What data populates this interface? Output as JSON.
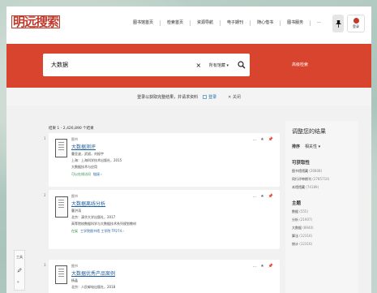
{
  "header": {
    "logo_text": "明远搜索",
    "nav": [
      "图书馆首页",
      "检索首页",
      "资源导航",
      "电子期刊",
      "随心借书",
      "图书服务",
      "···"
    ],
    "login_label": "登录",
    "pin_icon": "pin-icon"
  },
  "search": {
    "query": "大数据",
    "clear_symbol": "×",
    "scope": "所有馆藏 ▾",
    "advanced": "高级检索"
  },
  "notice": {
    "text": "登录以获取完整结果，并请求资料",
    "login_label": "登录",
    "dismiss_label": "✕ 关闭"
  },
  "results": {
    "count_text": "结果 1 - 2,426,890 个结果",
    "items": [
      {
        "num": "1",
        "type": "图书",
        "title": "大数据测评",
        "line1": "曹亚波，武斌，刘振宇",
        "line2": "上海：上海科学技术出版社，2015",
        "line3": "大数据技术与应用",
        "avail": "可以在线访问",
        "avail_more": "链接 ›"
      },
      {
        "num": "2",
        "type": "图书",
        "title": "大数据离线分析",
        "line1": "曹洪涛",
        "line2": "北京：清华大学出版社，2017",
        "line3": "高等院校数据科学与大数据技术系列规划教材",
        "avail": "在架",
        "avail_more": "工学院图书馆 工学院 TP274 ›"
      },
      {
        "num": "3",
        "type": "图书",
        "title": "大数据优秀产品案例",
        "line1": "杨晶",
        "line2": "北京：人民邮电出版社，2018",
        "line3": "",
        "avail": "",
        "avail_more": ""
      }
    ],
    "action_icons": [
      "...",
      "★",
      "📌"
    ]
  },
  "facets": {
    "heading": "调整您的结果",
    "sort_label": "排序",
    "sort_value": "相关性 ▾",
    "availability_label": "可获取性",
    "availability_items": [
      {
        "name": "图书馆馆藏",
        "count": "(26808)"
      },
      {
        "name": "同行评审期刊",
        "count": "(2785710)"
      },
      {
        "name": "本馆馆藏",
        "count": "(74189)"
      }
    ],
    "subject_label": "主题",
    "subject_items": [
      {
        "name": "数据",
        "count": "(555)"
      },
      {
        "name": "分析",
        "count": "(21907)"
      },
      {
        "name": "大数据",
        "count": "(8940)"
      },
      {
        "name": "算法",
        "count": "(12316)"
      },
      {
        "name": "统计",
        "count": "(12316)"
      }
    ]
  },
  "toolbox": {
    "label": "工具",
    "icons": [
      "edit-icon",
      "cite-icon"
    ]
  },
  "colors": {
    "brand_red": "#d9442e",
    "link_blue": "#1f5fa0",
    "available_green": "#2a8a4a"
  }
}
